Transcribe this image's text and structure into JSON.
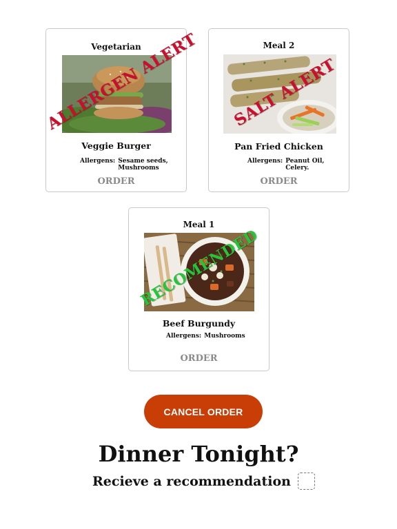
{
  "cards": [
    {
      "category": "Vegetarian",
      "stamp": "ALLERGEN ALERT",
      "stamp_color": "#c8102e",
      "name": "Veggie Burger",
      "allergens_label": "Allergens:",
      "allergens_value": "Sesame seeds,\nMushrooms",
      "order_label": "ORDER"
    },
    {
      "category": "Meal 2",
      "stamp": "SALT ALERT",
      "stamp_color": "#c8102e",
      "name": "Pan Fried Chicken",
      "allergens_label": "Allergens:",
      "allergens_value": "Peanut Oil,\nCelery.",
      "order_label": "ORDER"
    },
    {
      "category": "Meal 1",
      "stamp": "RECOMENDED",
      "stamp_color": "#27c33a",
      "name": "Beef Burgundy",
      "allergens_label": "Allergens:",
      "allergens_value": "Mushrooms",
      "order_label": "ORDER"
    }
  ],
  "cancel_button": "CANCEL ORDER",
  "headline": "Dinner Tonight?",
  "recommendation_label": "Recieve a recommendation",
  "colors": {
    "cancel_bg": "#c93d07",
    "order_text": "#8a8a8a",
    "card_border": "#c9c9c9"
  }
}
